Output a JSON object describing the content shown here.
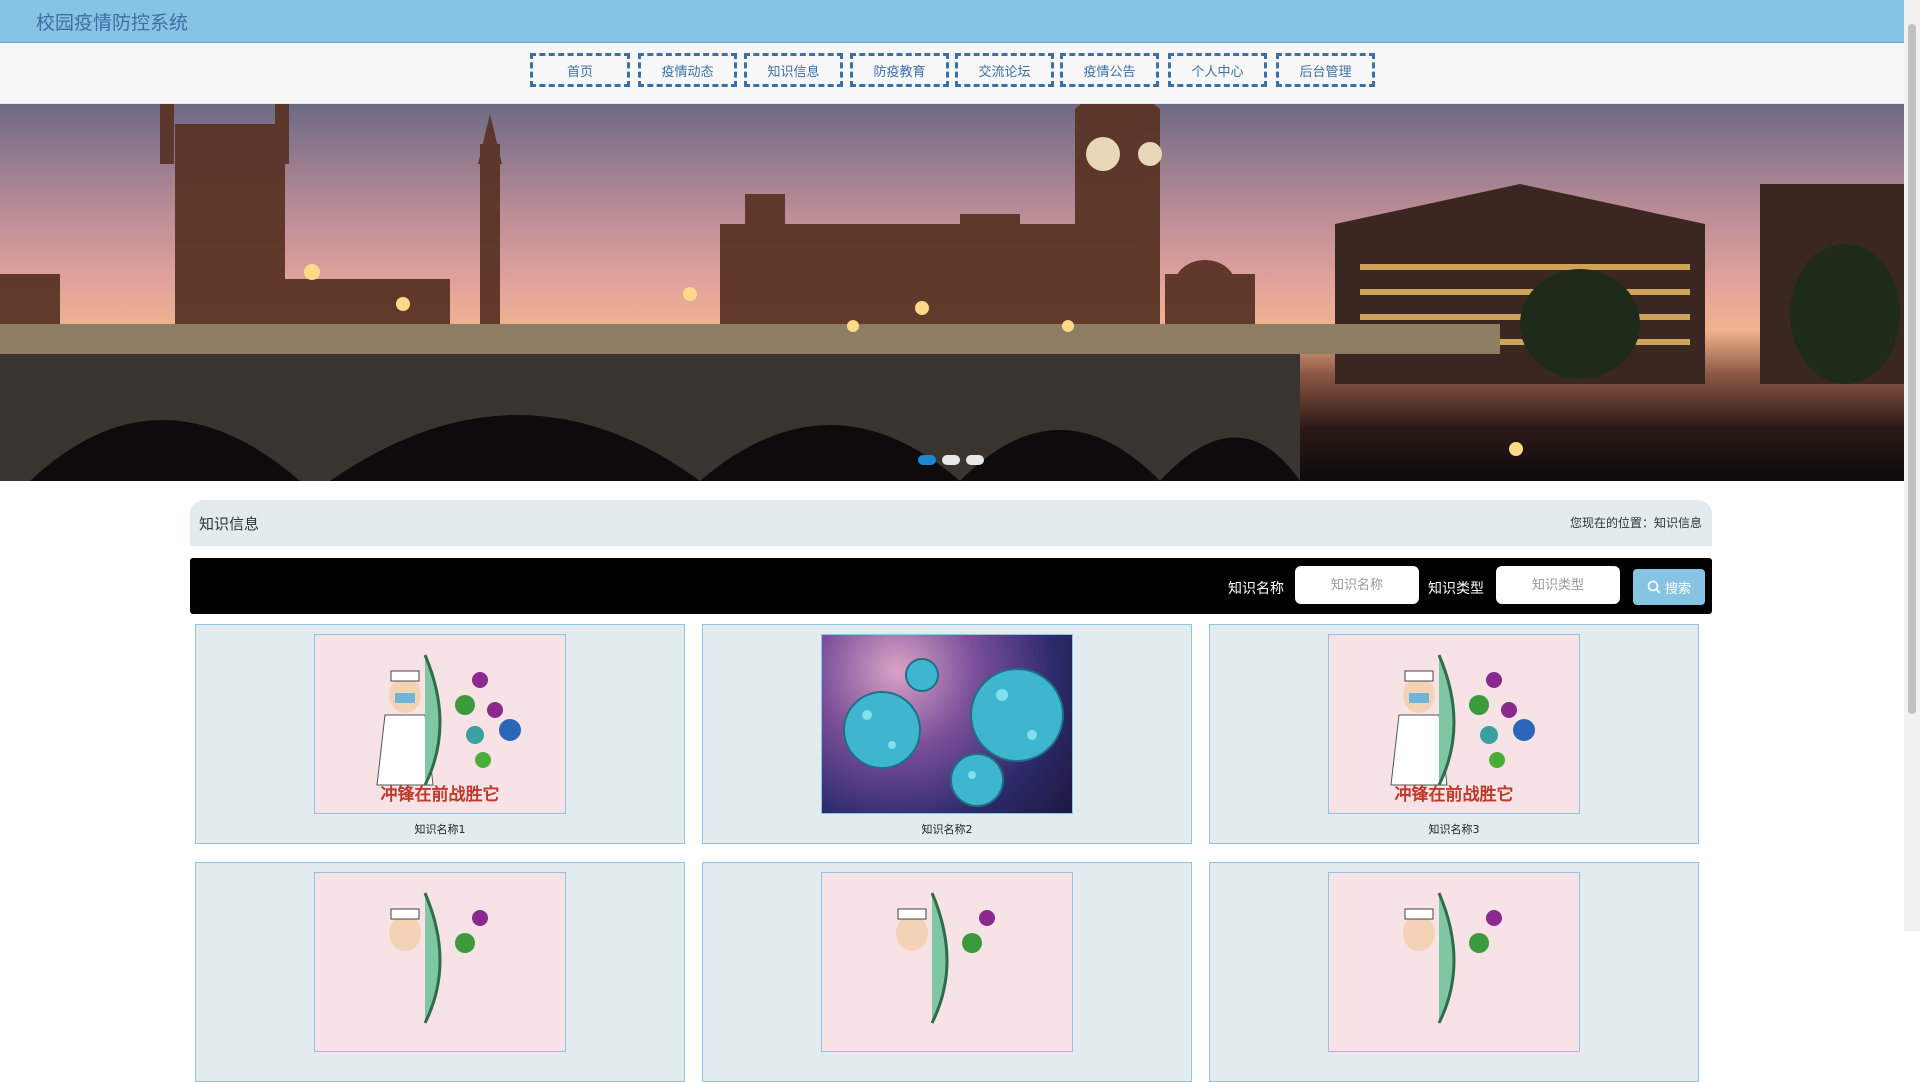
{
  "header": {
    "site_title": "校园疫情防控系统"
  },
  "nav": {
    "items": [
      {
        "label": "首页"
      },
      {
        "label": "疫情动态"
      },
      {
        "label": "知识信息"
      },
      {
        "label": "防疫教育"
      },
      {
        "label": "交流论坛"
      },
      {
        "label": "疫情公告"
      },
      {
        "label": "个人中心"
      },
      {
        "label": "后台管理"
      }
    ]
  },
  "carousel": {
    "slide_count": 3,
    "active_index": 0
  },
  "page": {
    "title": "知识信息",
    "breadcrumb": "您现在的位置：知识信息"
  },
  "search": {
    "name_label": "知识名称",
    "name_placeholder": "知识名称",
    "type_label": "知识类型",
    "type_placeholder": "知识类型",
    "button_label": "搜索",
    "button_icon": "search-icon"
  },
  "cards": [
    {
      "name": "知识名称1",
      "image": "doctor-shield-illustration",
      "image_caption": "冲锋在前战胜它"
    },
    {
      "name": "知识名称2",
      "image": "virus-3d-render"
    },
    {
      "name": "知识名称3",
      "image": "doctor-shield-illustration",
      "image_caption": "冲锋在前战胜它"
    },
    {
      "name": "",
      "image": "doctor-shield-illustration"
    },
    {
      "name": "",
      "image": "doctor-shield-illustration"
    },
    {
      "name": "",
      "image": "doctor-shield-illustration"
    }
  ],
  "colors": {
    "header_bg": "#87c4e4",
    "nav_text": "#3b6fa8",
    "card_bg": "#e2ebee",
    "card_border": "#8cc6e4",
    "dot_active": "#1e88d6"
  }
}
